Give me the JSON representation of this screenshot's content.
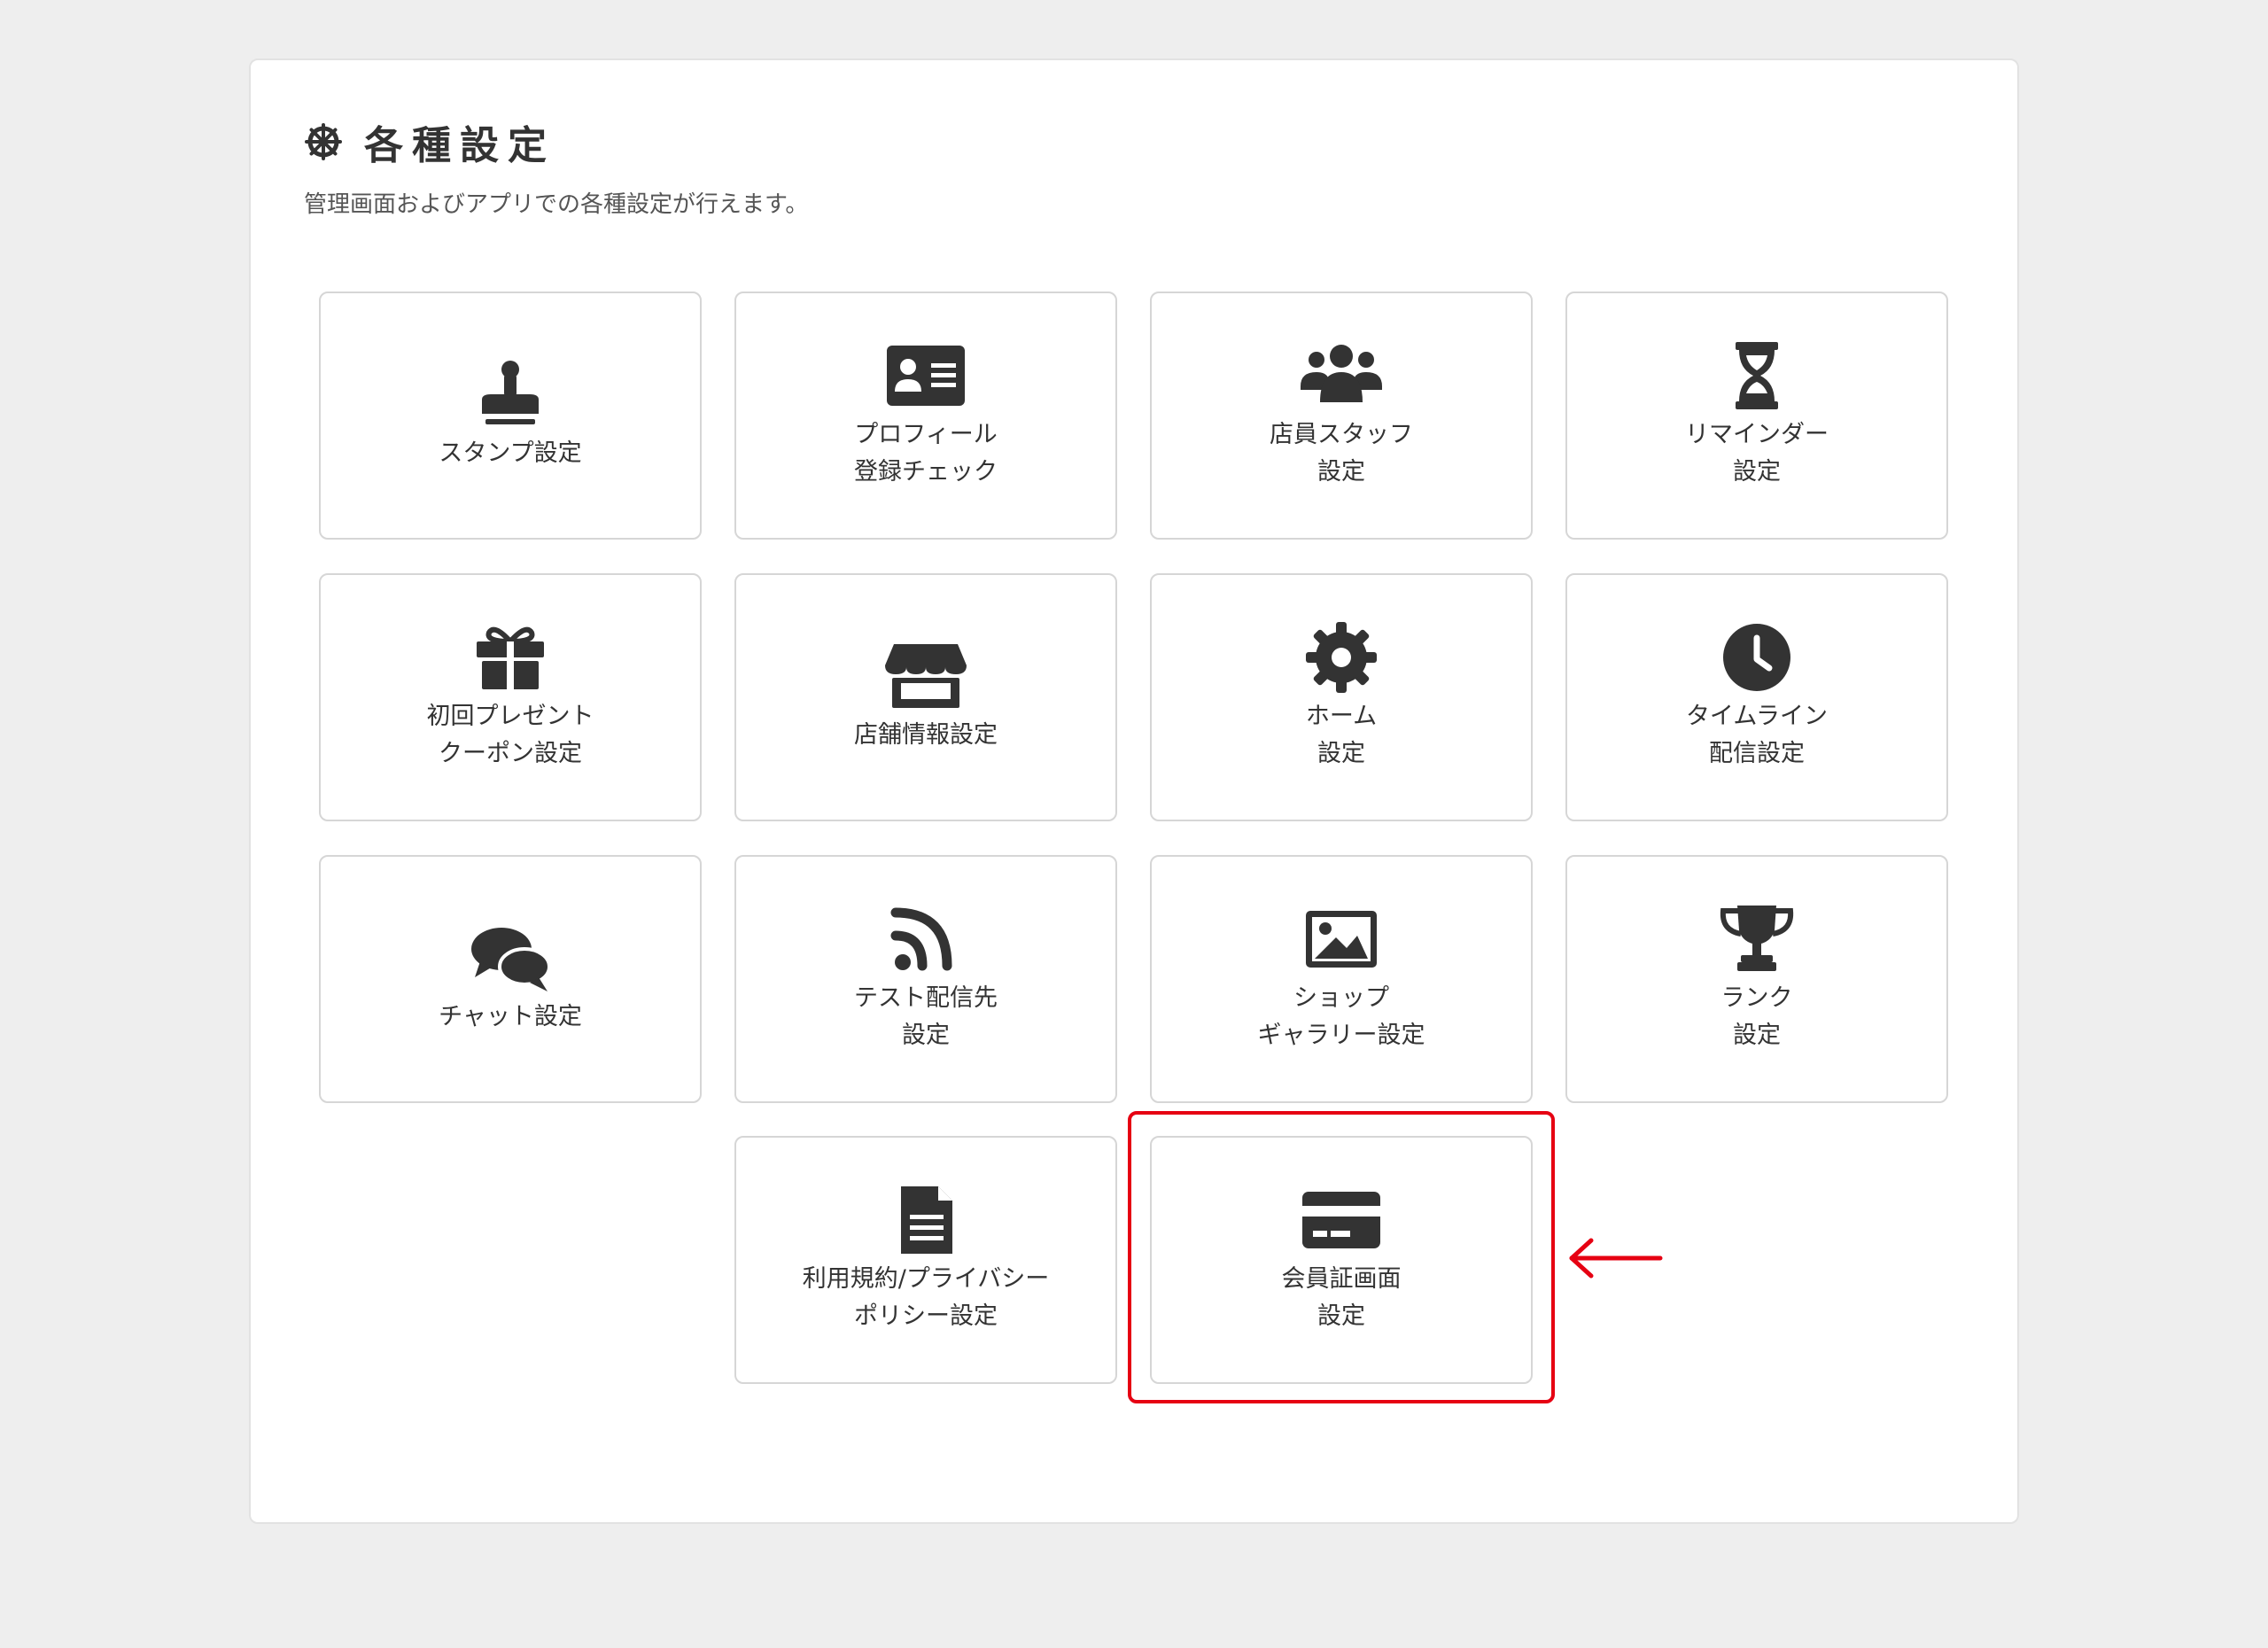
{
  "header": {
    "title": "各種設定",
    "title_icon": "gear-wheel-icon",
    "subtitle": "管理画面およびアプリでの各種設定が行えます。"
  },
  "tiles": [
    {
      "label": "スタンプ設定",
      "icon": "stamp-icon"
    },
    {
      "label": "プロフィール\n登録チェック",
      "icon": "id-card-icon"
    },
    {
      "label": "店員スタッフ\n設定",
      "icon": "users-icon"
    },
    {
      "label": "リマインダー\n設定",
      "icon": "hourglass-icon"
    },
    {
      "label": "初回プレゼント\nクーポン設定",
      "icon": "gift-icon"
    },
    {
      "label": "店舗情報設定",
      "icon": "store-icon"
    },
    {
      "label": "ホーム\n設定",
      "icon": "gear-icon"
    },
    {
      "label": "タイムライン\n配信設定",
      "icon": "clock-icon"
    },
    {
      "label": "チャット設定",
      "icon": "chat-icon"
    },
    {
      "label": "テスト配信先\n設定",
      "icon": "rss-icon"
    },
    {
      "label": "ショップ\nギャラリー設定",
      "icon": "image-icon"
    },
    {
      "label": "ランク\n設定",
      "icon": "trophy-icon"
    },
    {
      "label": "利用規約/プライバシー\nポリシー設定",
      "icon": "document-icon"
    },
    {
      "label": "会員証画面\n設定",
      "icon": "credit-card-icon"
    }
  ],
  "annotation": {
    "highlight_color": "#e60012",
    "highlighted_tile": "会員証画面\n設定",
    "arrow": "left-arrow"
  },
  "colors": {
    "background": "#eeeeee",
    "panel": "#ffffff",
    "icon": "#333333",
    "text": "#333333"
  }
}
